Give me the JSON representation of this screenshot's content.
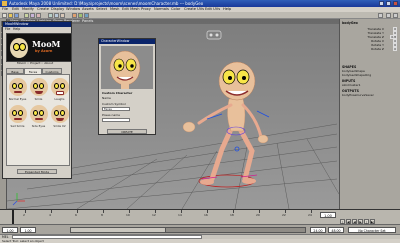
{
  "window": {
    "title": "Autodesk Maya 2008 Unlimited: D:\\Maya\\projects\\moom\\scenes\\moomCharacter.mb --- bodyGeo",
    "controls": [
      "minimize-icon",
      "maximize-icon",
      "close-icon"
    ]
  },
  "menubar": [
    "File",
    "Edit",
    "Modify",
    "Create",
    "Display",
    "Window",
    "Assets",
    "Select",
    "Mesh",
    "Edit Mesh",
    "Proxy",
    "Normals",
    "Color",
    "Create UVs",
    "Edit UVs",
    "Help"
  ],
  "viewport_menu": [
    "View",
    "Shading",
    "Lighting",
    "Show",
    "Renderer",
    "Panels"
  ],
  "moom_window": {
    "title": "MooMWindow",
    "menu": [
      "File",
      "Help"
    ],
    "logo": "MooM",
    "logo_sub": "by Acorn",
    "project_label": "Moom :: Project :: About",
    "tabs": [
      "Base",
      "Faces",
      "Customs"
    ],
    "faces": [
      "Normal Eyes",
      "Smile",
      "Laughs",
      "Sad Smile",
      "Side Eyes",
      "Smile 02"
    ],
    "button_label": "Expanded Mode"
  },
  "create_window": {
    "title": "CharacterWindow",
    "heading": "Custom Character",
    "name_label": "Name",
    "type_label": "Custom Symbol",
    "type_value": "Faces",
    "pose_label": "Poses name",
    "button_label": "CREATE"
  },
  "channel_box": {
    "object": "bodyGeo",
    "channels": [
      {
        "name": "Translate X",
        "value": "0"
      },
      {
        "name": "Translate Y",
        "value": "0"
      },
      {
        "name": "Translate Z",
        "value": "0.8"
      },
      {
        "name": "Rotate X",
        "value": "0"
      },
      {
        "name": "Rotate Y",
        "value": "0"
      },
      {
        "name": "Rotate Z",
        "value": "0"
      }
    ],
    "shapes_label": "SHAPES",
    "shapes": [
      "bodyGeoShape",
      "bodyGeoShapeOrig"
    ],
    "inputs_label": "INPUTS",
    "inputs": [
      "skinCluster1"
    ],
    "outputs_label": "OUTPUTS",
    "outputs": [
      "bodyPoseCurveSaver"
    ]
  },
  "timeline": {
    "ticks": [
      "2",
      "4",
      "6",
      "8",
      "10",
      "12",
      "14",
      "16",
      "18",
      "20",
      "22",
      "24"
    ],
    "current_frame": "1.00",
    "playback": [
      "|◀",
      "◀|",
      "◀",
      "▶",
      "|▶",
      "▶|"
    ]
  },
  "range": {
    "start": "1.00",
    "inner_start": "1.00",
    "inner_end": "24.00",
    "end": "48.00",
    "fps": "No Character Set"
  },
  "command_line": {
    "label": "MEL"
  },
  "help_line": "Select Tool: select an object"
}
